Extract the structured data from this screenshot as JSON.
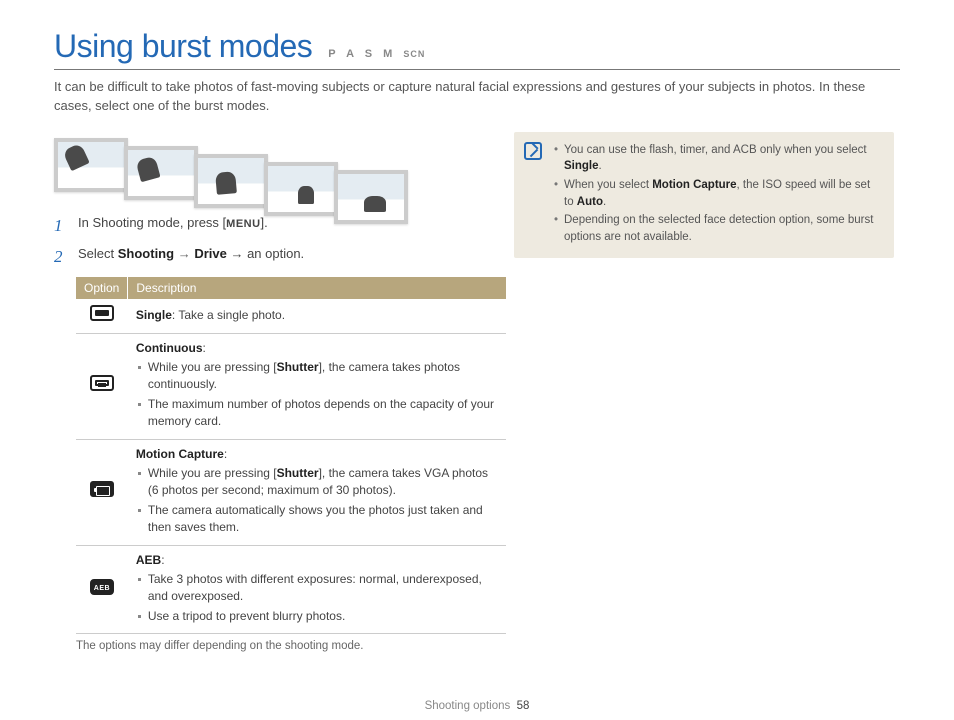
{
  "title": "Using burst modes",
  "mode_tags": [
    "P",
    "A",
    "S",
    "M",
    "SCN"
  ],
  "intro": "It can be difficult to take photos of fast-moving subjects or capture natural facial expressions and gestures of your subjects in photos. In these cases, select one of the burst modes.",
  "steps": {
    "s1_a": "In Shooting mode, press [",
    "s1_menu": "MENU",
    "s1_b": "].",
    "s2_a": "Select ",
    "s2_b1": "Shooting",
    "s2_arrow": " → ",
    "s2_b2": "Drive",
    "s2_c": " → an option."
  },
  "table": {
    "header_option": "Option",
    "header_desc": "Description",
    "rows": [
      {
        "icon": "single",
        "title": "Single",
        "tail": ": Take a single photo."
      },
      {
        "icon": "continuous",
        "title": "Continuous",
        "tail": ":",
        "bullets_a": "While you are pressing [",
        "bullets_a_bold": "Shutter",
        "bullets_a2": "], the camera takes photos continuously.",
        "bullets_b": "The maximum number of photos depends on the capacity of your memory card."
      },
      {
        "icon": "motion",
        "title": "Motion Capture",
        "tail": ":",
        "bullets_a": "While you are pressing [",
        "bullets_a_bold": "Shutter",
        "bullets_a2": "], the camera takes VGA photos (6 photos per second; maximum of 30 photos).",
        "bullets_b": "The camera automatically shows you the photos just taken and then saves them."
      },
      {
        "icon": "aeb",
        "title": "AEB",
        "tail": ":",
        "bullets_a_plain": "Take 3 photos with different exposures: normal, underexposed, and overexposed.",
        "bullets_b": "Use a tripod to prevent blurry photos."
      }
    ],
    "disclaimer": "The options may differ depending on the shooting mode."
  },
  "notes": {
    "n1_a": "You can use the flash, timer, and ACB only when you select ",
    "n1_b": "Single",
    "n1_c": ".",
    "n2_a": "When you select ",
    "n2_b": "Motion Capture",
    "n2_c": ", the ISO speed will be set to ",
    "n2_d": "Auto",
    "n2_e": ".",
    "n3": "Depending on the selected face detection option, some burst options are not available."
  },
  "footer": {
    "section": "Shooting options",
    "page": "58"
  }
}
